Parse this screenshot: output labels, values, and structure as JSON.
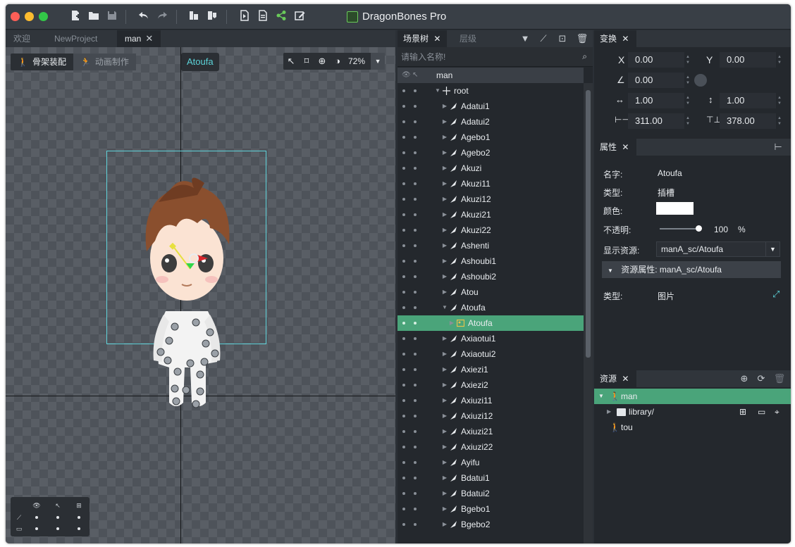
{
  "window": {
    "title": "DragonBones Pro"
  },
  "toolbar": {
    "icons": [
      "new-file-icon",
      "open-folder-icon",
      "save-icon",
      "undo-icon",
      "redo-icon",
      "import-icon",
      "export-icon",
      "publish-icon",
      "export-data-icon",
      "share-icon",
      "edit-icon"
    ]
  },
  "editor_tabs": [
    {
      "label": "欢迎"
    },
    {
      "label": "NewProject"
    },
    {
      "label": "man",
      "active": true
    }
  ],
  "stage": {
    "modes": [
      {
        "label": "骨架装配",
        "active": true
      },
      {
        "label": "动画制作",
        "active": false
      }
    ],
    "selected_object": "Atoufa",
    "zoom": "72%"
  },
  "scene_tree": {
    "tabs": [
      {
        "label": "场景树",
        "active": true
      },
      {
        "label": "层级",
        "active": false
      }
    ],
    "search_placeholder": "请输入名称!",
    "root_label": "man",
    "rows": [
      {
        "label": "root",
        "level": 0,
        "expanded": true,
        "type": "root"
      },
      {
        "label": "Adatui1",
        "level": 1,
        "type": "bone"
      },
      {
        "label": "Adatui2",
        "level": 1,
        "type": "bone"
      },
      {
        "label": "Agebo1",
        "level": 1,
        "type": "bone"
      },
      {
        "label": "Agebo2",
        "level": 1,
        "type": "bone"
      },
      {
        "label": "Akuzi",
        "level": 1,
        "type": "bone"
      },
      {
        "label": "Akuzi11",
        "level": 1,
        "type": "bone"
      },
      {
        "label": "Akuzi12",
        "level": 1,
        "type": "bone"
      },
      {
        "label": "Akuzi21",
        "level": 1,
        "type": "bone"
      },
      {
        "label": "Akuzi22",
        "level": 1,
        "type": "bone"
      },
      {
        "label": "Ashenti",
        "level": 1,
        "type": "bone"
      },
      {
        "label": "Ashoubi1",
        "level": 1,
        "type": "bone"
      },
      {
        "label": "Ashoubi2",
        "level": 1,
        "type": "bone"
      },
      {
        "label": "Atou",
        "level": 1,
        "type": "bone"
      },
      {
        "label": "Atoufa",
        "level": 1,
        "expanded": true,
        "type": "bone"
      },
      {
        "label": "Atoufa",
        "level": 2,
        "type": "slot",
        "selected": true
      },
      {
        "label": "Axiaotui1",
        "level": 1,
        "type": "bone"
      },
      {
        "label": "Axiaotui2",
        "level": 1,
        "type": "bone"
      },
      {
        "label": "Axiezi1",
        "level": 1,
        "type": "bone"
      },
      {
        "label": "Axiezi2",
        "level": 1,
        "type": "bone"
      },
      {
        "label": "Axiuzi11",
        "level": 1,
        "type": "bone"
      },
      {
        "label": "Axiuzi12",
        "level": 1,
        "type": "bone"
      },
      {
        "label": "Axiuzi21",
        "level": 1,
        "type": "bone"
      },
      {
        "label": "Axiuzi22",
        "level": 1,
        "type": "bone"
      },
      {
        "label": "Ayifu",
        "level": 1,
        "type": "bone"
      },
      {
        "label": "Bdatui1",
        "level": 1,
        "type": "bone"
      },
      {
        "label": "Bdatui2",
        "level": 1,
        "type": "bone"
      },
      {
        "label": "Bgebo1",
        "level": 1,
        "type": "bone"
      },
      {
        "label": "Bgebo2",
        "level": 1,
        "type": "bone"
      }
    ]
  },
  "transform": {
    "title": "变换",
    "x_label": "X",
    "x": "0.00",
    "y_label": "Y",
    "y": "0.00",
    "rotation": "0.00",
    "scale_x": "1.00",
    "scale_y": "1.00",
    "width": "311.00",
    "height": "378.00"
  },
  "properties": {
    "title": "属性",
    "name_label": "名字:",
    "name": "Atoufa",
    "type_label": "类型:",
    "type": "插槽",
    "color_label": "颜色:",
    "color": "#ffffff",
    "opacity_label": "不透明:",
    "opacity": "100",
    "opacity_unit": "%",
    "display_label": "显示资源:",
    "display": "manA_sc/Atoufa",
    "resource_attr": "资源属性: manA_sc/Atoufa",
    "res_type_label": "类型:",
    "res_type": "图片"
  },
  "assets": {
    "title": "资源",
    "rows": [
      {
        "label": "man",
        "selected": true
      },
      {
        "label": "library/"
      },
      {
        "label": "tou"
      }
    ]
  },
  "colors": {
    "accent": "#4aa47a",
    "cyan": "#5cd3d9"
  }
}
